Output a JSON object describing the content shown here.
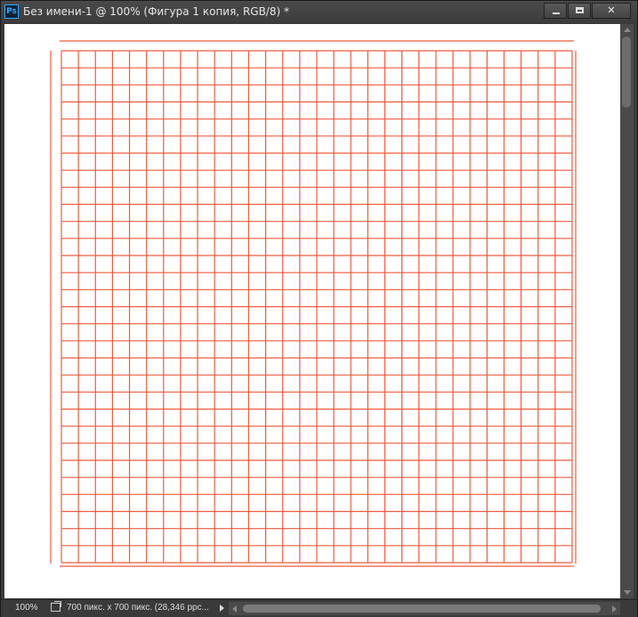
{
  "window": {
    "app_icon": "Ps",
    "title": "Без имени-1 @ 100% (Фигура 1 копия, RGB/8) *",
    "buttons": {
      "minimize": "minimize-icon",
      "maximize": "maximize-icon",
      "close": "close-icon",
      "close_glyph": "✕"
    }
  },
  "canvas": {
    "background": "#ffffff",
    "grid_color": "#f05a3c",
    "grid_columns": 31,
    "grid_rows": 31
  },
  "status": {
    "zoom": "100%",
    "doc_info": "700 пикс. x 700 пикс. (28,346 ppc..."
  }
}
